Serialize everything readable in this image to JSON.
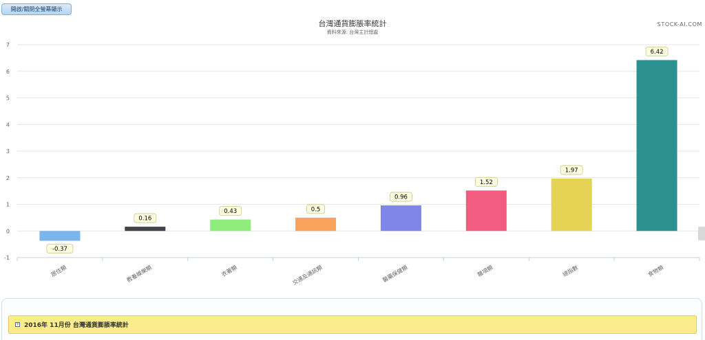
{
  "toolbar": {
    "fullscreen_toggle_label": "開啟/關閉全螢幕顯示"
  },
  "credits": "STOCK-AI.COM",
  "chart_data": {
    "type": "bar",
    "title": "台灣通貨膨脹率統計",
    "subtitle": "資料來源: 台灣主計總處",
    "xlabel": "",
    "ylabel": "",
    "categories": [
      "居住類",
      "教養娛樂類",
      "衣著類",
      "交通及通訊類",
      "醫藥保健類",
      "雜項類",
      "總指數",
      "食物類"
    ],
    "values": [
      -0.37,
      0.16,
      0.43,
      0.5,
      0.96,
      1.52,
      1.97,
      6.42
    ],
    "value_labels": [
      "-0.37",
      "0.16",
      "0.43",
      "0.5",
      "0.96",
      "1.52",
      "1.97",
      "6.42"
    ],
    "colors": [
      "#7cb5ec",
      "#434348",
      "#90ed7d",
      "#f7a35c",
      "#8085e9",
      "#f15c80",
      "#e4d354",
      "#2b908f"
    ],
    "yticks": [
      -1,
      0,
      1,
      2,
      3,
      4,
      5,
      6,
      7
    ],
    "ylim": [
      -1,
      7
    ],
    "grid": true,
    "legend": "none"
  },
  "panel": {
    "title": "2016年 11月份 台灣通貨膨脹率統計",
    "icon": "expand-plus-icon"
  }
}
